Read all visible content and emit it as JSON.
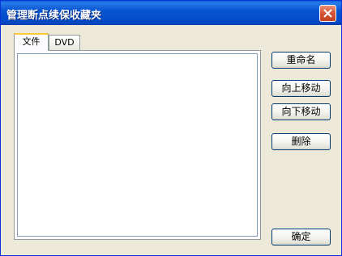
{
  "window": {
    "title": "管理断点续保收藏夹"
  },
  "tabs": [
    {
      "label": "文件",
      "active": true
    },
    {
      "label": "DVD",
      "active": false
    }
  ],
  "buttons": {
    "rename": "重命名",
    "move_up": "向上移动",
    "move_down": "向下移动",
    "delete": "删除",
    "ok": "确定"
  },
  "colors": {
    "titlebar": "#0755d3",
    "window_bg": "#ece9d8",
    "close_button": "#d9573a",
    "active_tab_accent": "#ffc83c"
  }
}
